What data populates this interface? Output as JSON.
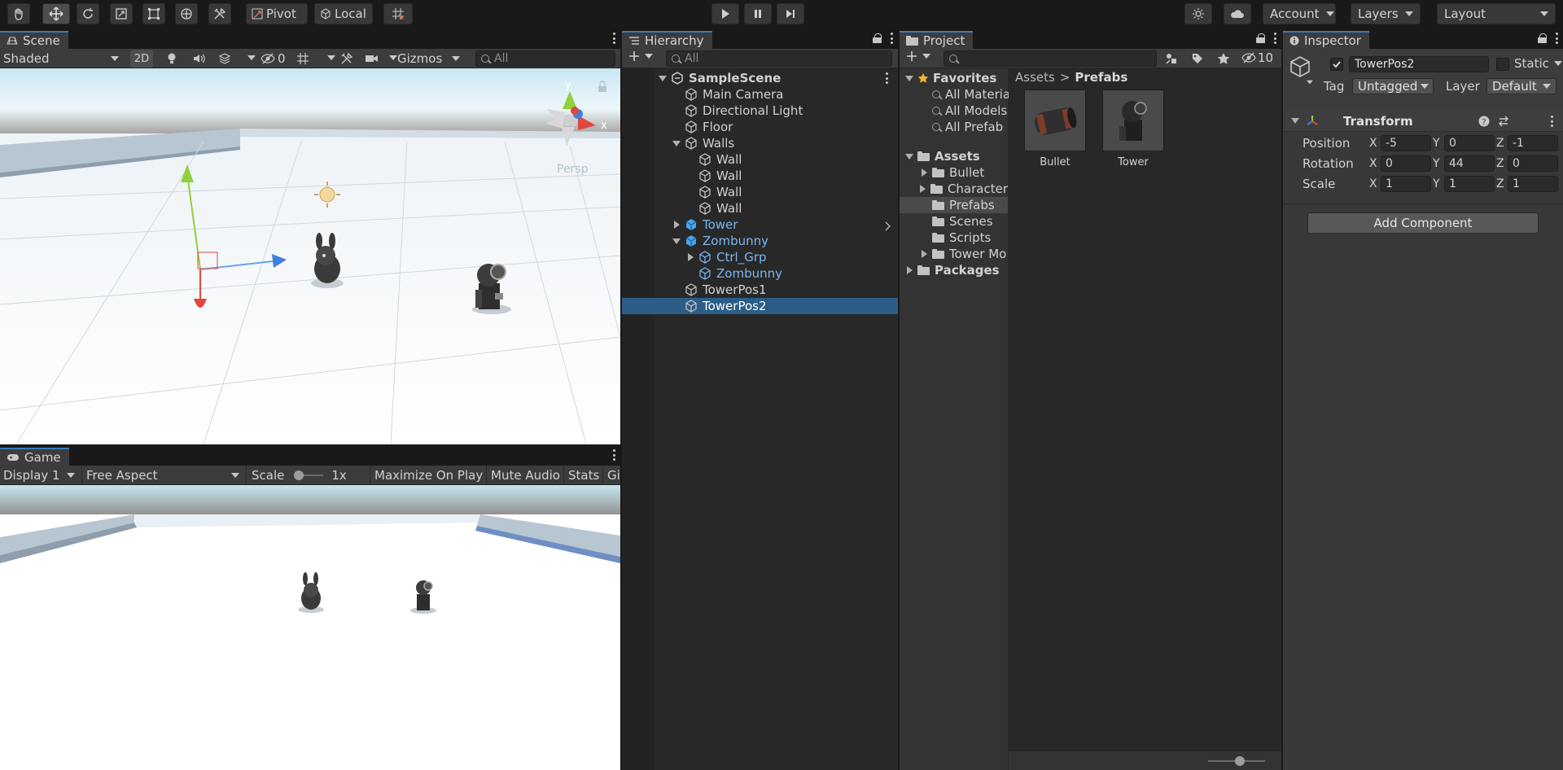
{
  "toolbar": {
    "pivot_label": "Pivot",
    "local_label": "Local",
    "account_label": "Account",
    "layers_label": "Layers",
    "layout_label": "Layout"
  },
  "scene": {
    "tab_label": "Scene",
    "shading_mode": "Shaded",
    "mode_2d": "2D",
    "hidden_count": "0",
    "gizmos_label": "Gizmos",
    "search_placeholder": "All",
    "persp_label": "Persp",
    "axis_y": "y",
    "axis_x": "x"
  },
  "game": {
    "tab_label": "Game",
    "display": "Display 1",
    "aspect": "Free Aspect",
    "scale_label": "Scale",
    "scale_value": "1x",
    "maximize_label": "Maximize On Play",
    "mute_label": "Mute Audio",
    "stats_label": "Stats",
    "gizmos_cut": "Gi"
  },
  "hierarchy": {
    "tab_label": "Hierarchy",
    "search_placeholder": "All",
    "items": [
      {
        "label": "SampleScene",
        "depth": 0,
        "kind": "scene",
        "expanded": true
      },
      {
        "label": "Main Camera",
        "depth": 1,
        "kind": "object"
      },
      {
        "label": "Directional Light",
        "depth": 1,
        "kind": "object"
      },
      {
        "label": "Floor",
        "depth": 1,
        "kind": "object"
      },
      {
        "label": "Walls",
        "depth": 1,
        "kind": "object",
        "expanded": true
      },
      {
        "label": "Wall",
        "depth": 2,
        "kind": "object"
      },
      {
        "label": "Wall",
        "depth": 2,
        "kind": "object"
      },
      {
        "label": "Wall",
        "depth": 2,
        "kind": "object"
      },
      {
        "label": "Wall",
        "depth": 2,
        "kind": "object"
      },
      {
        "label": "Tower",
        "depth": 1,
        "kind": "prefab",
        "expanded": false
      },
      {
        "label": "Zombunny",
        "depth": 1,
        "kind": "prefab",
        "expanded": true
      },
      {
        "label": "Ctrl_Grp",
        "depth": 2,
        "kind": "prefab-child",
        "expanded": false
      },
      {
        "label": "Zombunny",
        "depth": 2,
        "kind": "prefab-child"
      },
      {
        "label": "TowerPos1",
        "depth": 1,
        "kind": "object"
      },
      {
        "label": "TowerPos2",
        "depth": 1,
        "kind": "object",
        "selected": true
      }
    ]
  },
  "project": {
    "tab_label": "Project",
    "hidden_count": "10",
    "breadcrumb_root": "Assets",
    "breadcrumb_sep": ">",
    "breadcrumb_current": "Prefabs",
    "favorites_label": "Favorites",
    "favorites": [
      "All Materia",
      "All Models",
      "All Prefab"
    ],
    "assets_label": "Assets",
    "folders": [
      {
        "label": "Bullet",
        "has_children": true
      },
      {
        "label": "Character",
        "has_children": true
      },
      {
        "label": "Prefabs",
        "has_children": false,
        "selected": true
      },
      {
        "label": "Scenes",
        "has_children": false
      },
      {
        "label": "Scripts",
        "has_children": false
      },
      {
        "label": "Tower Mo",
        "has_children": true
      }
    ],
    "packages_label": "Packages",
    "assets_grid": [
      {
        "label": "Bullet"
      },
      {
        "label": "Tower"
      }
    ],
    "zoom_fraction": 0.55
  },
  "inspector": {
    "tab_label": "Inspector",
    "object_name": "TowerPos2",
    "static_label": "Static",
    "tag_label": "Tag",
    "tag_value": "Untagged",
    "layer_label": "Layer",
    "layer_value": "Default",
    "component_title": "Transform",
    "position_label": "Position",
    "rotation_label": "Rotation",
    "scale_label": "Scale",
    "axis_x": "X",
    "axis_y": "Y",
    "axis_z": "Z",
    "position": {
      "x": "-5",
      "y": "0",
      "z": "-1"
    },
    "rotation": {
      "x": "0",
      "y": "44",
      "z": "0"
    },
    "scale": {
      "x": "1",
      "y": "1",
      "z": "1"
    },
    "add_component_label": "Add Component"
  },
  "colors": {
    "accent": "#3a79bb",
    "selection": "#2c5d87",
    "prefab_text": "#7cb7f4"
  }
}
